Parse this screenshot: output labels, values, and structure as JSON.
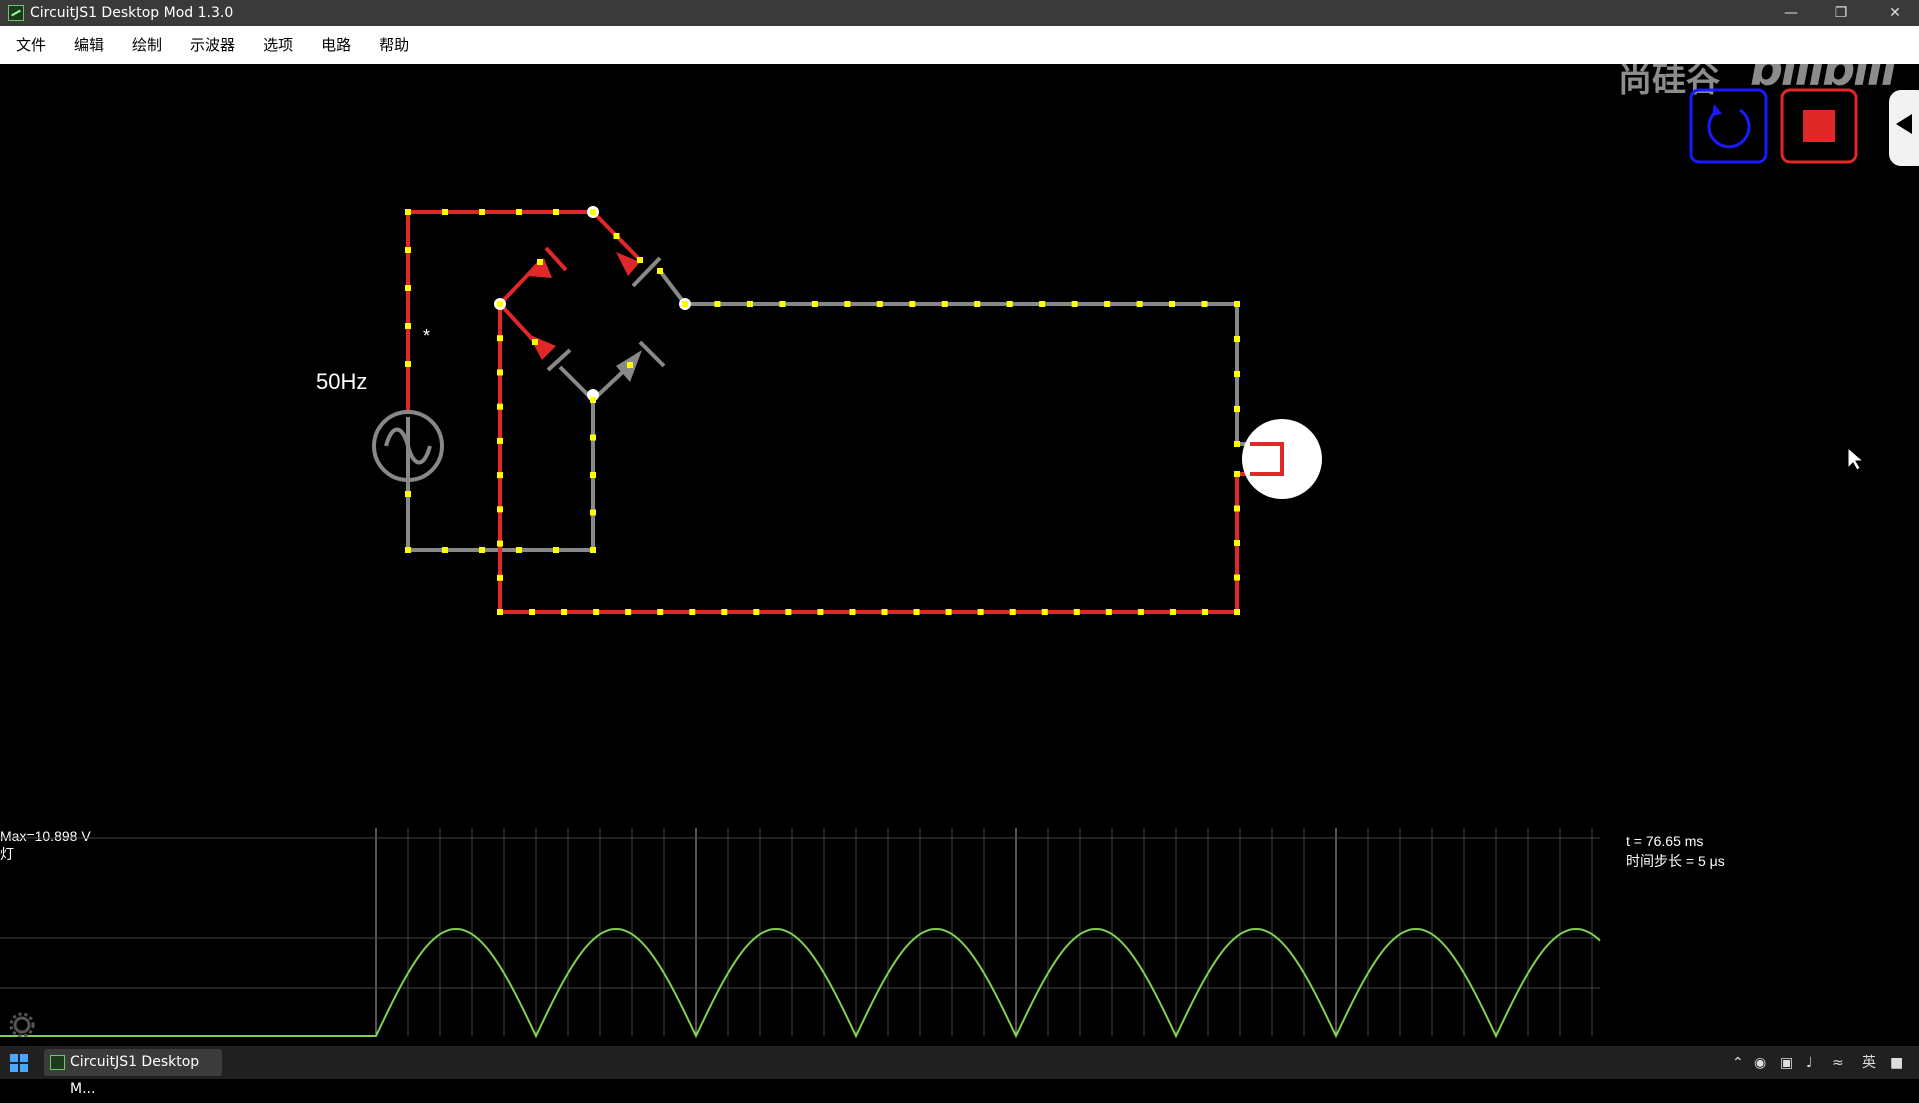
{
  "window": {
    "title": "CircuitJS1 Desktop Mod 1.3.0"
  },
  "menu": {
    "items": [
      "文件",
      "编辑",
      "绘制",
      "示波器",
      "选项",
      "电路",
      "帮助"
    ]
  },
  "watermark": {
    "brand_cn": "尚硅谷",
    "brand_logo": "bilibili"
  },
  "controls": {
    "reset_icon": "reset-icon",
    "stop_icon": "stop-icon",
    "sidebar_toggle_icon": "triangle-left-icon"
  },
  "circuit": {
    "source_label": "50Hz",
    "source_marker": "*"
  },
  "scope": {
    "max_label": "Max=10.898 V",
    "element_label": "灯",
    "time_label": "t = 76.65 ms",
    "timestep_label": "时间步长 = 5 μs",
    "settings_icon": "gear-icon",
    "trace_color": "#7fd14f"
  },
  "taskbar": {
    "task_label": "CircuitJS1 Desktop M...",
    "ime_label": "英"
  },
  "colors": {
    "wire_active": "#e02828",
    "wire_idle": "#888888",
    "current_dot": "#ffff00",
    "accent_blue": "#1a1aff",
    "accent_red": "#e02828"
  }
}
